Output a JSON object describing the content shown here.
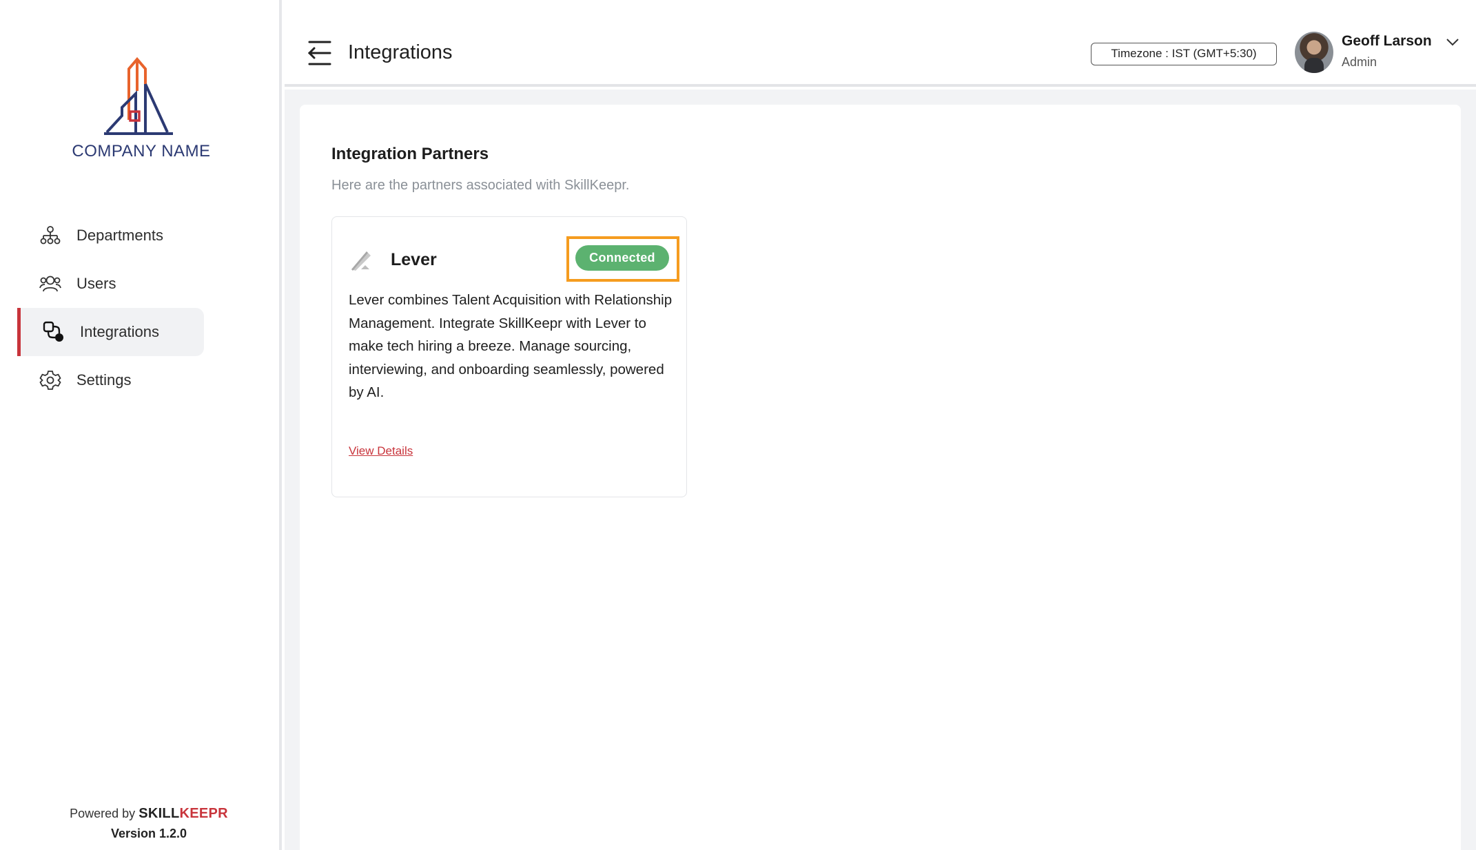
{
  "sidebar": {
    "company_name": "COMPANY NAME",
    "items": [
      {
        "label": "Departments",
        "icon": "org-chart-icon",
        "active": false
      },
      {
        "label": "Users",
        "icon": "users-icon",
        "active": false
      },
      {
        "label": "Integrations",
        "icon": "integrations-icon",
        "active": true
      },
      {
        "label": "Settings",
        "icon": "gear-icon",
        "active": false
      }
    ],
    "powered_by": "Powered by",
    "brand_part1": "SKILL",
    "brand_part2": "KEEPR",
    "version": "Version 1.2.0"
  },
  "header": {
    "title": "Integrations",
    "timezone": "Timezone : IST (GMT+5:30)",
    "user_name": "Geoff Larson",
    "user_role": "Admin"
  },
  "main": {
    "section_title": "Integration Partners",
    "section_subtitle": "Here are the partners associated with SkillKeepr.",
    "partners": [
      {
        "name": "Lever",
        "status": "Connected",
        "description": "Lever combines Talent Acquisition with Relationship Management. Integrate SkillKeepr with Lever to make tech hiring a breeze. Manage sourcing, interviewing, and onboarding seamlessly, powered by AI.",
        "link_label": "View Details"
      }
    ]
  },
  "colors": {
    "accent": "#c8343b",
    "connected": "#5cb270",
    "highlight": "#f59c1f",
    "logo_navy": "#2c3a73",
    "logo_orange": "#e8632c"
  }
}
